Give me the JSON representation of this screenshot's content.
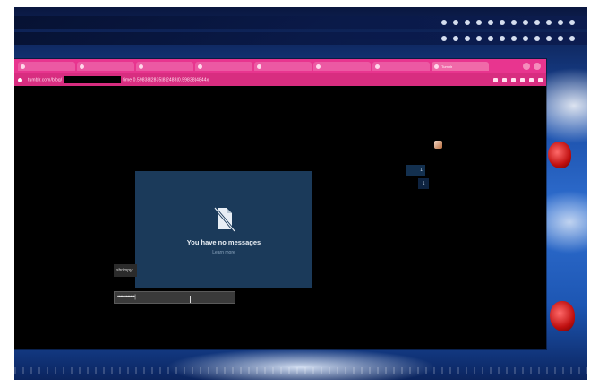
{
  "browser": {
    "tabs": [
      {
        "label": "",
        "active": false
      },
      {
        "label": "",
        "active": false
      },
      {
        "label": "",
        "active": false
      },
      {
        "label": "",
        "active": false
      },
      {
        "label": "",
        "active": false
      },
      {
        "label": "",
        "active": false
      },
      {
        "label": "",
        "active": false
      },
      {
        "label": "Tumblr",
        "active": true
      }
    ],
    "url_prefix": "tumblr.com/blog/",
    "url_suffix": "time 0.59838|2835|8|2483|0.59838|4844x"
  },
  "messages": {
    "empty_title": "You have no messages",
    "learn_more": "Learn more"
  },
  "login": {
    "name_chip": "shrimpy",
    "password_mask": "••••••••••••|"
  },
  "badges": {
    "right_count": "1",
    "right_count_2": "1"
  },
  "colors": {
    "tab_bar": "#e8358f",
    "address_bar": "#d82d80",
    "panel": "#1b3a5a"
  }
}
